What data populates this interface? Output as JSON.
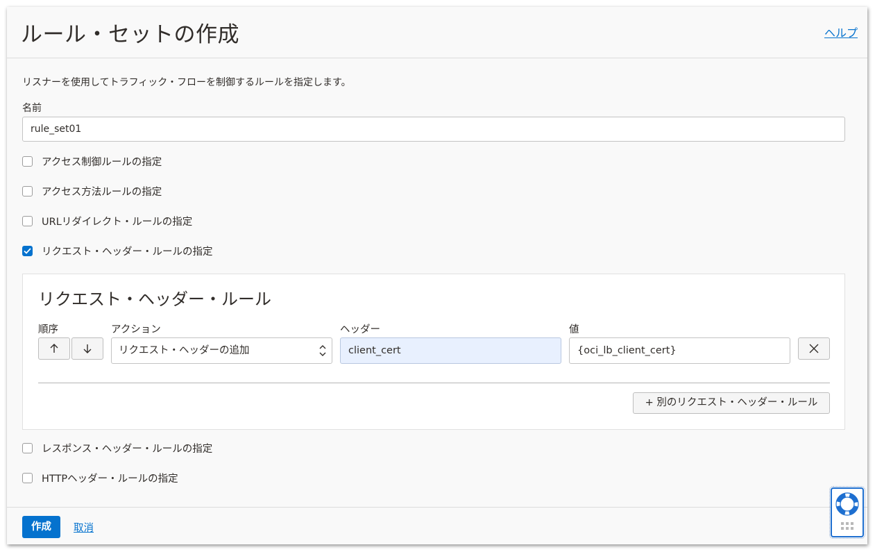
{
  "header": {
    "title": "ルール・セットの作成",
    "help_label": "ヘルプ"
  },
  "form": {
    "description": "リスナーを使用してトラフィック・フローを制御するルールを指定します。",
    "name_label": "名前",
    "name_value": "rule_set01",
    "checkboxes": [
      {
        "label": "アクセス制御ルールの指定",
        "checked": false
      },
      {
        "label": "アクセス方法ルールの指定",
        "checked": false
      },
      {
        "label": "URLリダイレクト・ルールの指定",
        "checked": false
      },
      {
        "label": "リクエスト・ヘッダー・ルールの指定",
        "checked": true
      },
      {
        "label": "レスポンス・ヘッダー・ルールの指定",
        "checked": false
      },
      {
        "label": "HTTPヘッダー・ルールの指定",
        "checked": false
      }
    ]
  },
  "request_header_rules": {
    "title": "リクエスト・ヘッダー・ルール",
    "columns": {
      "order": "順序",
      "action": "アクション",
      "header": "ヘッダー",
      "value": "値"
    },
    "rule": {
      "action": "リクエスト・ヘッダーの追加",
      "header": "client_cert",
      "value": "{oci_lb_client_cert}"
    },
    "add_button_label": "+ 別のリクエスト・ヘッダー・ルール"
  },
  "footer": {
    "create_label": "作成",
    "cancel_label": "取消"
  },
  "colors": {
    "accent": "#0572ce",
    "highlight_field": "#e8f0fe"
  },
  "icons": {
    "up": "arrow-up-icon",
    "down": "arrow-down-icon",
    "remove": "close-icon",
    "select": "chevron-updown-icon",
    "support": "lifebuoy-icon",
    "grip": "grip-dots-icon",
    "check": "checkmark-icon"
  }
}
